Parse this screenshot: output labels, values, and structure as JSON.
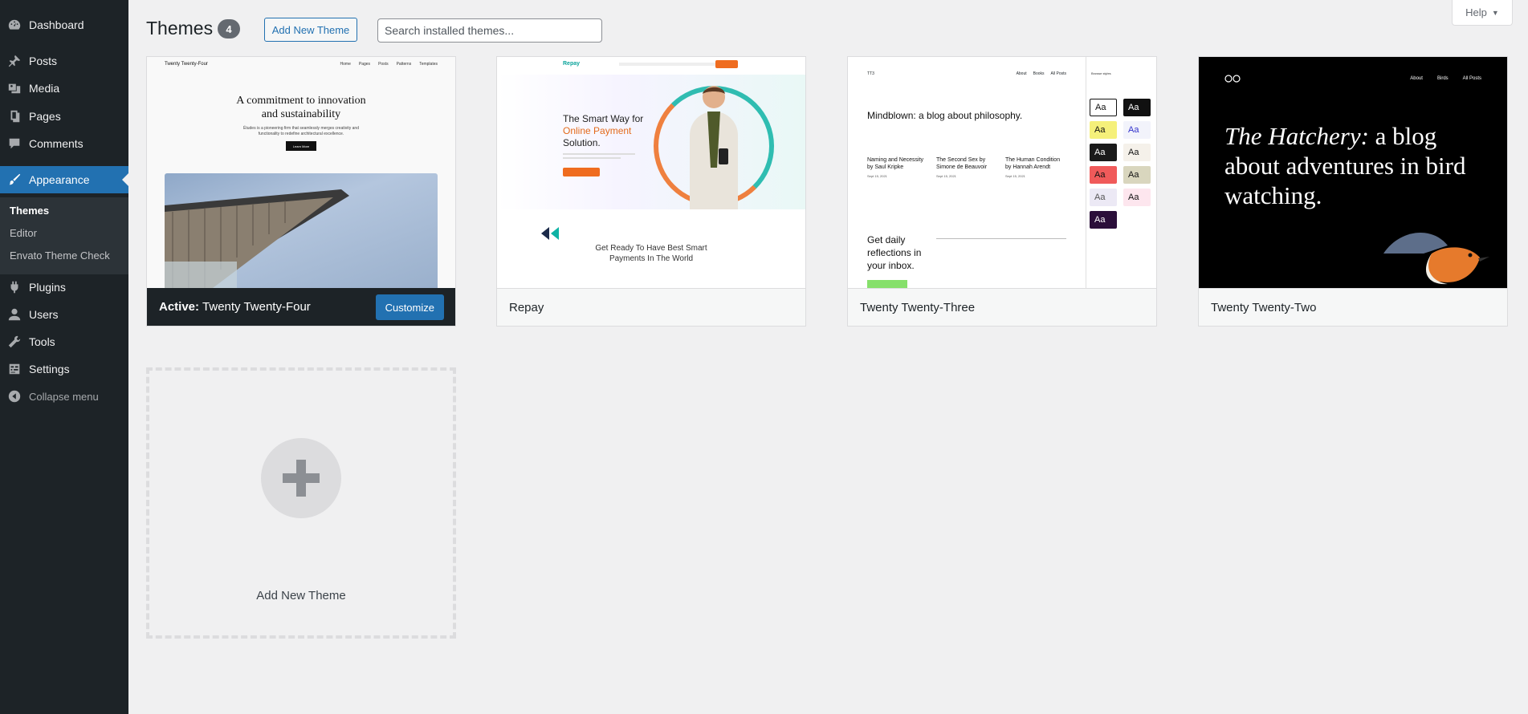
{
  "sidebar": {
    "items": [
      {
        "label": "Dashboard",
        "icon": "dashboard-icon"
      },
      {
        "label": "Posts",
        "icon": "pushpin-icon"
      },
      {
        "label": "Media",
        "icon": "media-icon"
      },
      {
        "label": "Pages",
        "icon": "pages-icon"
      },
      {
        "label": "Comments",
        "icon": "comment-icon"
      },
      {
        "label": "Appearance",
        "icon": "paintbrush-icon"
      },
      {
        "label": "Plugins",
        "icon": "plugin-icon"
      },
      {
        "label": "Users",
        "icon": "user-icon"
      },
      {
        "label": "Tools",
        "icon": "wrench-icon"
      },
      {
        "label": "Settings",
        "icon": "settings-icon"
      }
    ],
    "submenu": [
      "Themes",
      "Editor",
      "Envato Theme Check"
    ],
    "collapse_label": "Collapse menu"
  },
  "header": {
    "title": "Themes",
    "count": "4",
    "add_new_label": "Add New Theme",
    "search_placeholder": "Search installed themes...",
    "help_label": "Help"
  },
  "themes": [
    {
      "name": "Twenty Twenty-Four",
      "active_prefix": "Active:",
      "customize_label": "Customize",
      "preview": {
        "site_title": "Twenty Twenty-Four",
        "nav": [
          "Home",
          "Pages",
          "Posts",
          "Patterns",
          "Templates"
        ],
        "hero": "A commitment to innovation and sustainability",
        "description": "Études is a pioneering firm that seamlessly merges creativity and functionality to redefine architectural excellence.",
        "button": "Learn More"
      }
    },
    {
      "name": "Repay",
      "preview": {
        "logo": "Repay",
        "headline_1": "The Smart Way for",
        "headline_2": "Online Payment",
        "headline_3": "Solution.",
        "subheadline": "Get Ready To Have Best Smart Payments In The World"
      }
    },
    {
      "name": "Twenty Twenty-Three",
      "preview": {
        "site_title": "TT3",
        "nav": [
          "About",
          "Books",
          "All Posts"
        ],
        "title": "Mindblown: a blog about philosophy.",
        "posts": [
          {
            "title": "Naming and Necessity by Saul Kripke",
            "date": "Sept 15, 2021"
          },
          {
            "title": "The Second Sex by Simone de Beauvoir",
            "date": "Sept 15, 2021"
          },
          {
            "title": "The Human Condition by Hannah Arendt",
            "date": "Sept 15, 2021"
          }
        ],
        "daily": "Get daily reflections in your inbox.",
        "panel_title": "Browse styles",
        "swatch_text": "Aa"
      }
    },
    {
      "name": "Twenty Twenty-Two",
      "preview": {
        "nav": [
          "About",
          "Birds",
          "All Posts"
        ],
        "headline_italic": "The Hatchery:",
        "headline_rest": " a blog about adventures in bird watching."
      }
    }
  ],
  "add_new_card": {
    "label": "Add New Theme"
  },
  "colors": {
    "sidebar_bg": "#1d2327",
    "accent": "#2271b1",
    "page_bg": "#f0f0f1"
  }
}
